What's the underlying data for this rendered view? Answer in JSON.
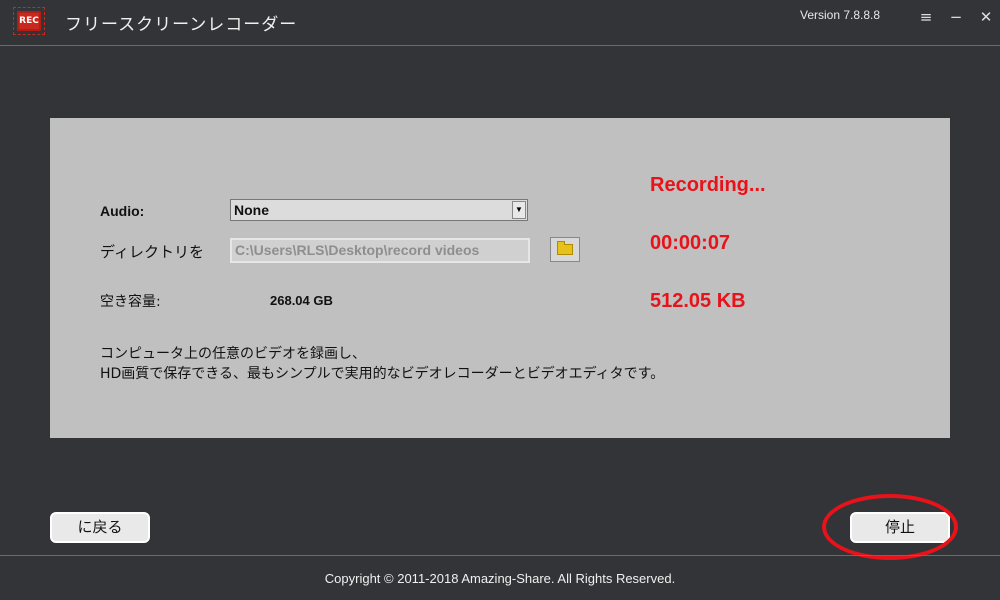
{
  "titlebar": {
    "logo_text": "REC",
    "app_title": "フリースクリーンレコーダー",
    "version": "Version 7.8.8.8",
    "menu_icon": "≡",
    "minimize_icon": "−",
    "close_icon": "✕"
  },
  "settings": {
    "audio_label": "Audio:",
    "audio_value": "None",
    "directory_label": "ディレクトリを",
    "directory_value": "C:\\Users\\RLS\\Desktop\\record videos",
    "free_space_label": "空き容量:",
    "free_space_value": "268.04 GB"
  },
  "status": {
    "state": "Recording...",
    "elapsed": "00:00:07",
    "size": "512.05 KB"
  },
  "description": {
    "line1": "コンピュータ上の任意のビデオを録画し、",
    "line2": "HD画質で保存できる、最もシンプルで実用的なビデオレコーダーとビデオエディタです。"
  },
  "buttons": {
    "back_label": "に戻る",
    "stop_label": "停止"
  },
  "footer": {
    "copyright": "Copyright © 2011-2018 Amazing-Share. All Rights Reserved."
  },
  "colors": {
    "background": "#333438",
    "panel": "#c0c0c0",
    "status_red": "#e8121a",
    "logo_red": "#c8281e"
  }
}
